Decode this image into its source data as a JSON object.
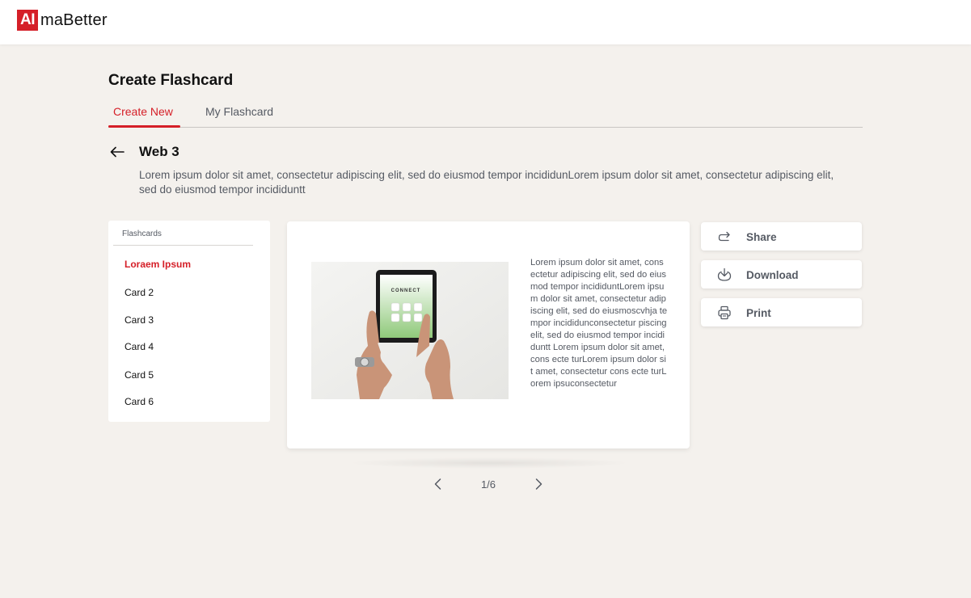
{
  "brand": {
    "logo_mark": "AI",
    "logo_rest": "maBetter"
  },
  "page": {
    "title": "Create Flashcard"
  },
  "tabs": [
    {
      "label": "Create New",
      "active": true
    },
    {
      "label": "My Flashcard",
      "active": false
    }
  ],
  "topic": {
    "title": "Web 3",
    "description": "Lorem ipsum dolor sit amet, consectetur adipiscing elit, sed do eiusmod tempor incididunLorem ipsum dolor sit amet, consectetur adipiscing elit, sed do eiusmod tempor incididuntt"
  },
  "flashcards": {
    "header": "Flashcards",
    "items": [
      {
        "label": "Loraem Ipsum",
        "active": true
      },
      {
        "label": "Card 2"
      },
      {
        "label": "Card 3"
      },
      {
        "label": "Card 4"
      },
      {
        "label": "Card 5"
      },
      {
        "label": "Card 6"
      }
    ]
  },
  "card": {
    "image_screen_text": "CONNECT",
    "body": "Lorem ipsum dolor sit amet, consectetur adipiscing elit, sed do eiusmod tempor incididuntLorem ipsum dolor sit amet, consectetur adipiscing elit, sed do eiusmoscvhja tempor incididunconsectetur piscing elit, sed do eiusmod tempor incididuntt Lorem ipsum dolor sit amet, cons ecte turLorem ipsum dolor sit amet, consectetur cons ecte turLorem ipsuconsectetur"
  },
  "pagination": {
    "current": 1,
    "total": 6,
    "label": "1/6"
  },
  "actions": {
    "share_label": "Share",
    "download_label": "Download",
    "print_label": "Print"
  },
  "colors": {
    "accent": "#d51f28",
    "background": "#f4f1ed",
    "muted_text": "#555a63"
  },
  "icons": {
    "back": "arrow-left-icon",
    "prev": "chevron-left-icon",
    "next": "chevron-right-icon",
    "share": "share-icon",
    "download": "download-icon",
    "print": "printer-icon"
  }
}
